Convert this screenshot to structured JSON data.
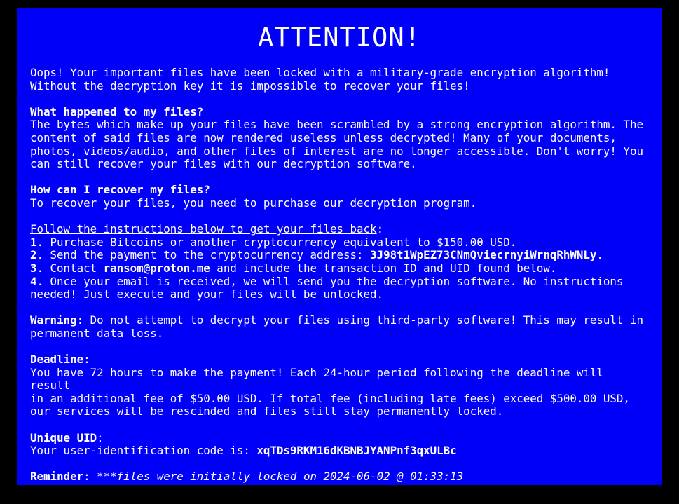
{
  "title": "ATTENTION!",
  "intro": {
    "line1": "Oops! Your important files have been locked with a military-grade encryption algorithm!",
    "line2": "Without the decryption key it is impossible to recover your files!"
  },
  "what_happened": {
    "heading": "What happened to my files?",
    "lines": [
      "The bytes which make up your files have been scrambled by a strong encryption algorithm. The",
      "content of said files are now rendered useless unless decrypted! Many of your documents,",
      "photos, videos/audio, and other files of interest are no longer accessible. Don't worry! You",
      "can still recover your files with our decryption software."
    ]
  },
  "recover": {
    "heading": "How can I recover my files?",
    "text": "To recover your files, you need to purchase our decryption program."
  },
  "instructions": {
    "heading": "Follow the instructions below to get your files back",
    "colon": ":",
    "steps": [
      {
        "num": "1",
        "pre": ". Purchase Bitcoins or another cryptocurrency equivalent to $150.00 USD.",
        "bold": "",
        "post": ""
      },
      {
        "num": "2",
        "pre": ". Send the payment to the cryptocurrency address: ",
        "bold": "3J98t1WpEZ73CNmQviecrnyiWrnqRhWNLy",
        "post": "."
      },
      {
        "num": "3",
        "pre": ". Contact ",
        "bold": "ransom@proton.me",
        "post": " and include the transaction ID and UID found below."
      },
      {
        "num": "4",
        "pre": ". Once your email is received, we will send you the decryption software. No instructions",
        "bold": "",
        "post": ""
      }
    ],
    "step4_line2": "needed! Just execute and your files will be unlocked."
  },
  "warning": {
    "label": "Warning",
    "text1": ": Do not attempt to decrypt your files using third-party software! This may result in",
    "text2": "permanent data loss."
  },
  "deadline": {
    "label": "Deadline",
    "colon": ":",
    "lines": [
      "You have 72 hours to make the payment! Each 24-hour period following the deadline will result",
      "in an additional fee of $50.00 USD. If total fee (including late fees) exceed $500.00 USD,",
      "our services will be rescinded and files still stay permanently locked."
    ]
  },
  "uid": {
    "label": "Unique UID",
    "colon": ":",
    "text": "Your user-identification code is: ",
    "code": "xqTDs9RKM16dKBNBJYANPnf3qxULBc"
  },
  "reminder": {
    "label": "Reminder",
    "colon": ": ",
    "text": "***files were initially locked on 2024-06-02 @ 01:33:13"
  },
  "colors": {
    "background": "#0000f8",
    "frame": "#000000",
    "text": "#ffffff"
  }
}
